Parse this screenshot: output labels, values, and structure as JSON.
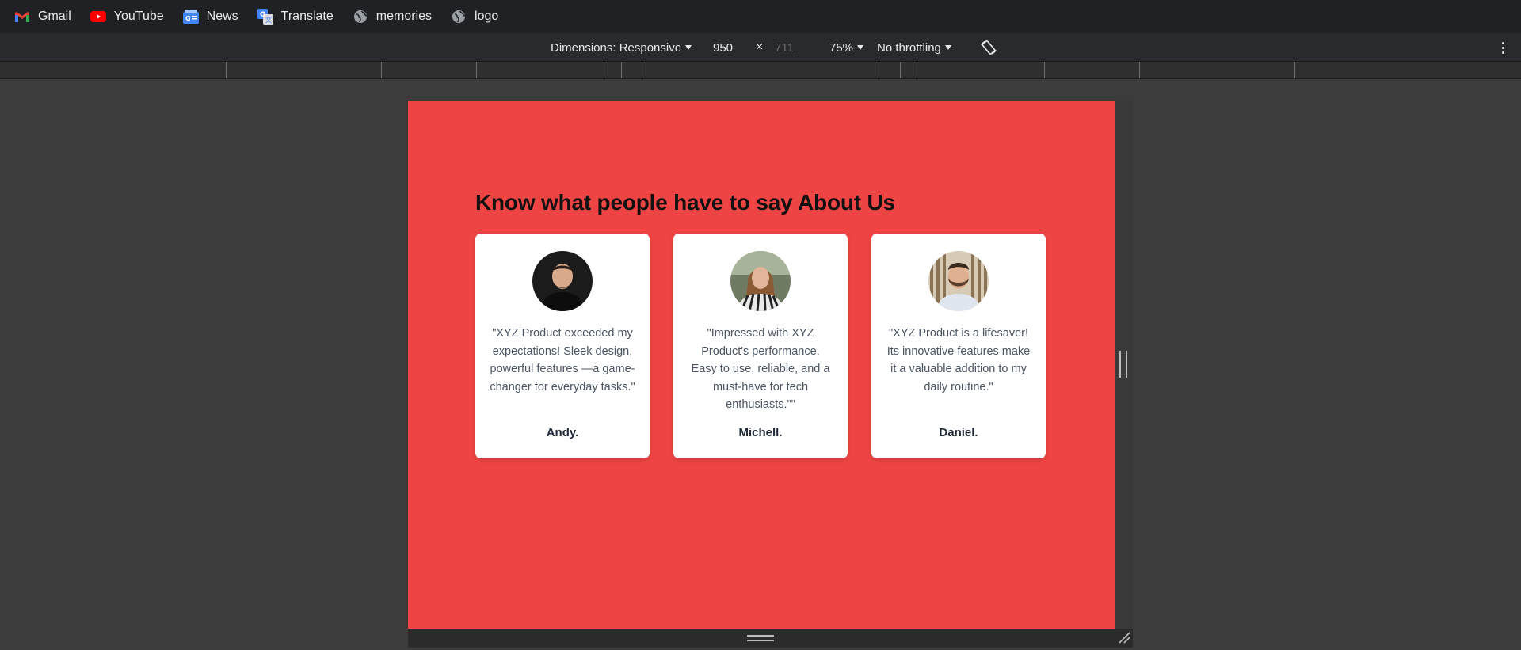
{
  "bookmarks": [
    {
      "label": "Gmail",
      "icon": "gmail-icon"
    },
    {
      "label": "YouTube",
      "icon": "youtube-icon"
    },
    {
      "label": "News",
      "icon": "news-icon"
    },
    {
      "label": "Translate",
      "icon": "translate-icon"
    },
    {
      "label": "memories",
      "icon": "globe-icon"
    },
    {
      "label": "logo",
      "icon": "globe-icon"
    }
  ],
  "devtools": {
    "dimensions_label": "Dimensions: Responsive",
    "width": "950",
    "times": "×",
    "height": "711",
    "zoom": "75%",
    "throttling": "No throttling",
    "rotate_icon": "rotate-icon",
    "more_icon": "more-vert-icon"
  },
  "page": {
    "background": "#ef4444",
    "heading": "Know what people have to say About Us",
    "testimonials": [
      {
        "quote": "\"XYZ Product exceeded my expectations! Sleek design, powerful features —a game-changer for everyday tasks.\"",
        "name": "Andy.",
        "avatar": "man-in-black-shirt-avatar"
      },
      {
        "quote": "\"Impressed with XYZ Product's performance. Easy to use, reliable, and a must-have for tech enthusiasts.\"\"",
        "name": "Michell.",
        "avatar": "woman-in-striped-shirt-avatar"
      },
      {
        "quote": "\"XYZ Product is a lifesaver! Its innovative features make it a valuable addition to my daily routine.\"",
        "name": "Daniel.",
        "avatar": "bearded-man-avatar"
      }
    ]
  }
}
